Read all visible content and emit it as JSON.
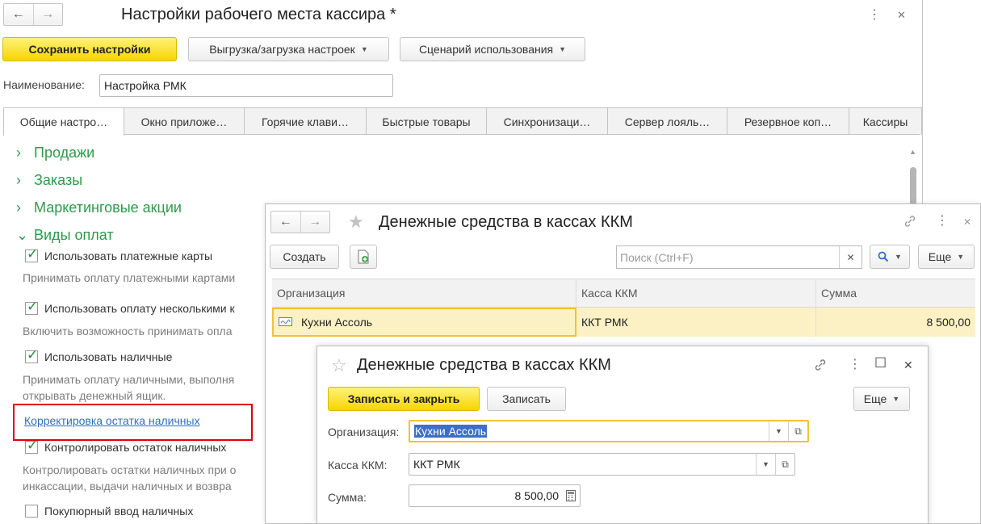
{
  "win1": {
    "title": "Настройки рабочего места кассира *",
    "buttons": {
      "save": "Сохранить настройки",
      "export": "Выгрузка/загрузка настроек",
      "scenario": "Сценарий использования"
    },
    "name_label": "Наименование:",
    "name_value": "Настройка РМК",
    "tabs": [
      "Общие настро…",
      "Окно приложе…",
      "Горячие клави…",
      "Быстрые товары",
      "Синхронизаци…",
      "Сервер лояль…",
      "Резервное коп…",
      "Кассиры"
    ],
    "groups": [
      "Продажи",
      "Заказы",
      "Маркетинговые акции",
      "Виды оплат"
    ],
    "options": [
      {
        "label": "Использовать платежные карты",
        "checked": true,
        "hint": "Принимать оплату платежными картами"
      },
      {
        "label": "Использовать оплату несколькими к",
        "checked": true,
        "hint": "Включить возможность принимать опла"
      },
      {
        "label": "Использовать наличные",
        "checked": true,
        "hint_1": "Принимать оплату наличными, выполня",
        "hint_2": "открывать денежный ящик."
      },
      {
        "label": "Контролировать остаток наличных",
        "checked": true,
        "hint_1": "Контролировать остатки наличных при о",
        "hint_2": "инкассации, выдачи наличных и возвра"
      },
      {
        "label": "Покупюрный ввод наличных",
        "checked": false
      }
    ],
    "link": "Корректировка остатка наличных"
  },
  "win2": {
    "title": "Денежные средства в кассах ККМ",
    "create": "Создать",
    "search_placeholder": "Поиск (Ctrl+F)",
    "more": "Еще",
    "columns": [
      "Организация",
      "Касса ККМ",
      "Сумма"
    ],
    "rows": [
      {
        "org": "Кухни Ассоль",
        "kassa": "ККТ РМК",
        "sum": "8 500,00"
      }
    ]
  },
  "win3": {
    "title": "Денежные средства в кассах ККМ",
    "save_close": "Записать и закрыть",
    "save": "Записать",
    "more": "Еще",
    "org_label": "Организация:",
    "org_value": "Кухни Ассоль",
    "kassa_label": "Касса ККМ:",
    "kassa_value": "ККТ РМК",
    "sum_label": "Сумма:",
    "sum_value": "8 500,00"
  },
  "icons": {
    "nav_back": "←",
    "nav_forward": "→",
    "more": "⋮",
    "close": "✕",
    "star": "★",
    "star_outline": "☆",
    "link": "🔗",
    "maximize": "☐",
    "search": "🔍",
    "chevron_right": "›",
    "chevron_down": "⌄"
  },
  "colors": {
    "accent_yellow": "#f6d500",
    "group_green": "#2e9a4a",
    "link_blue": "#2d6fc2",
    "highlight_red": "#e0000e",
    "row_selected": "#fbf1c4"
  }
}
